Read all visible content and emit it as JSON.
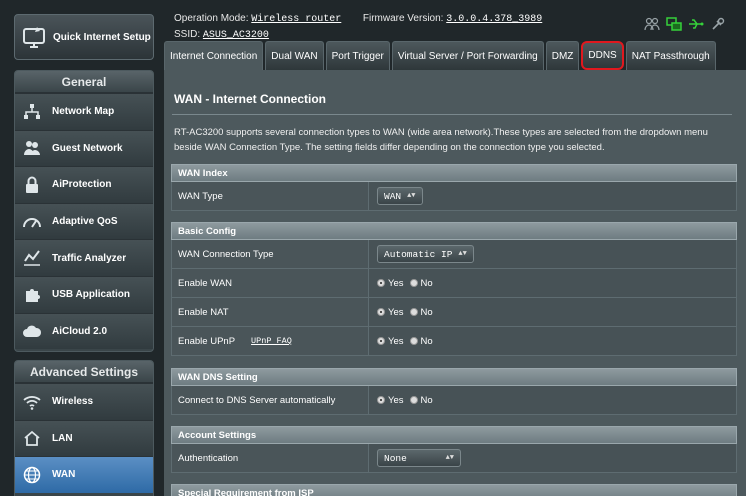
{
  "sidebar": {
    "quick_internet_setup": "Quick Internet Setup",
    "general": {
      "heading": "General",
      "items": [
        {
          "label": "Network Map",
          "icon": "network-map-icon"
        },
        {
          "label": "Guest Network",
          "icon": "guest-network-icon"
        },
        {
          "label": "AiProtection",
          "icon": "lock-icon"
        },
        {
          "label": "Adaptive QoS",
          "icon": "gauge-icon"
        },
        {
          "label": "Traffic Analyzer",
          "icon": "chart-icon"
        },
        {
          "label": "USB Application",
          "icon": "puzzle-icon"
        },
        {
          "label": "AiCloud 2.0",
          "icon": "cloud-icon"
        }
      ]
    },
    "advanced": {
      "heading": "Advanced Settings",
      "items": [
        {
          "label": "Wireless",
          "icon": "wifi-icon"
        },
        {
          "label": "LAN",
          "icon": "home-icon"
        },
        {
          "label": "WAN",
          "icon": "globe-icon"
        }
      ]
    }
  },
  "header": {
    "operation_mode_label": "Operation Mode:",
    "operation_mode_value": "Wireless router",
    "firmware_label": "Firmware Version:",
    "firmware_value": "3.0.0.4.378_3989",
    "ssid_label": "SSID:",
    "ssid_value": "ASUS_AC3200"
  },
  "tabs": [
    "Internet Connection",
    "Dual WAN",
    "Port Trigger",
    "Virtual Server / Port Forwarding",
    "DMZ",
    "DDNS",
    "NAT Passthrough"
  ],
  "main": {
    "title": "WAN - Internet Connection",
    "description": "RT-AC3200 supports several connection types to WAN (wide area network).These types are selected from the dropdown menu beside WAN Connection Type. The setting fields differ depending on the connection type you selected.",
    "sections": {
      "wan_index": {
        "heading": "WAN Index",
        "wan_type_label": "WAN Type",
        "wan_type_value": "WAN"
      },
      "basic_config": {
        "heading": "Basic Config",
        "conn_type_label": "WAN Connection Type",
        "conn_type_value": "Automatic IP",
        "enable_wan_label": "Enable WAN",
        "enable_nat_label": "Enable NAT",
        "enable_upnp_label": "Enable UPnP",
        "upnp_faq": "UPnP  FAQ"
      },
      "dns": {
        "heading": "WAN DNS Setting",
        "auto_dns_label": "Connect to DNS Server automatically"
      },
      "account": {
        "heading": "Account Settings",
        "auth_label": "Authentication",
        "auth_value": "None"
      },
      "special": {
        "heading": "Special Requirement from ISP"
      }
    },
    "yes": "Yes",
    "no": "No"
  }
}
